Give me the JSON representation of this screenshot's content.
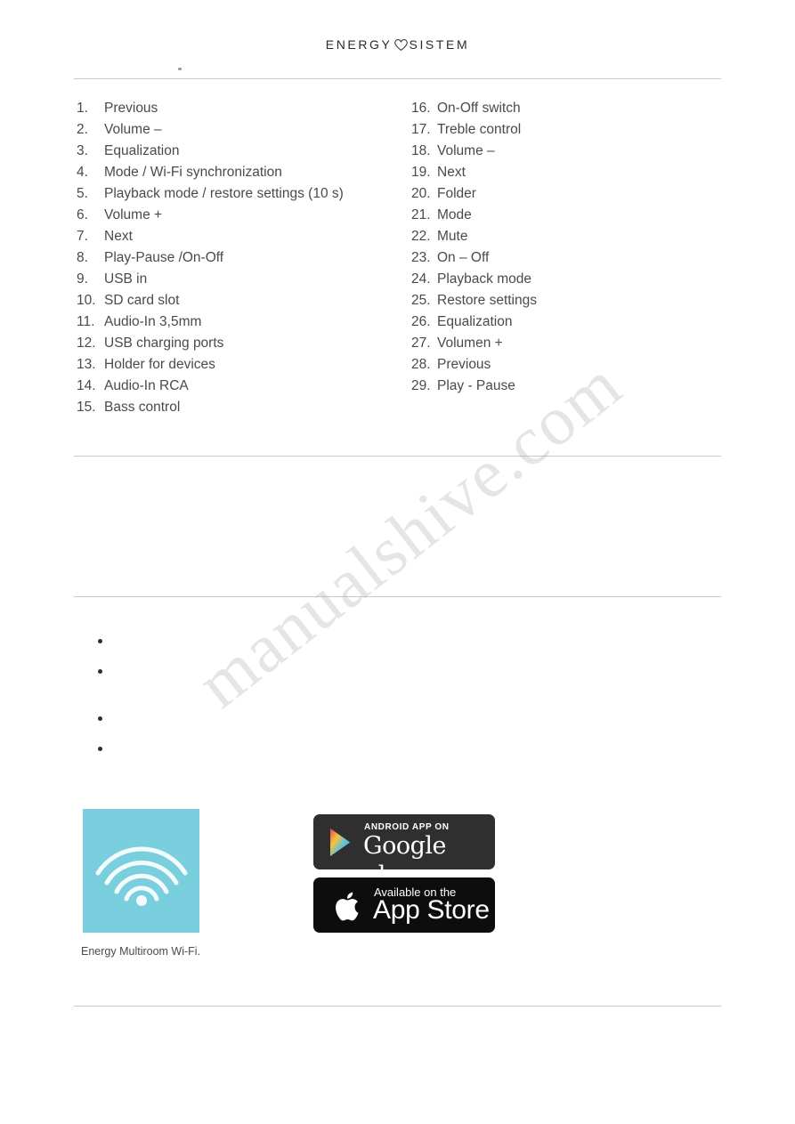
{
  "header": {
    "brand_left": "ENERGY",
    "brand_right": "SISTEM",
    "heart_icon": "heart-icon"
  },
  "parts_list": {
    "left_column": [
      {
        "num": "1.",
        "label": "Previous"
      },
      {
        "num": "2.",
        "label": "Volume –"
      },
      {
        "num": "3.",
        "label": "Equalization"
      },
      {
        "num": "4.",
        "label": "Mode / Wi-Fi synchronization"
      },
      {
        "num": "5.",
        "label": "Playback mode / restore settings (10 s)"
      },
      {
        "num": "6.",
        "label": "Volume +"
      },
      {
        "num": "7.",
        "label": "Next"
      },
      {
        "num": "8.",
        "label": "Play-Pause /On-Off"
      },
      {
        "num": "9.",
        "label": "USB in"
      },
      {
        "num": "10.",
        "label": "SD card slot"
      },
      {
        "num": "11.",
        "label": "Audio-In 3,5mm"
      },
      {
        "num": "12.",
        "label": "USB charging ports"
      },
      {
        "num": "13.",
        "label": "Holder for devices"
      },
      {
        "num": "14.",
        "label": "Audio-In RCA"
      },
      {
        "num": "15.",
        "label": "Bass control"
      }
    ],
    "right_column": [
      {
        "num": "16.",
        "label": "On-Off switch"
      },
      {
        "num": "17.",
        "label": "Treble control"
      },
      {
        "num": "18.",
        "label": "Volume –"
      },
      {
        "num": "19.",
        "label": "Next"
      },
      {
        "num": "20.",
        "label": "Folder"
      },
      {
        "num": "21.",
        "label": "Mode"
      },
      {
        "num": "22.",
        "label": "Mute"
      },
      {
        "num": "23.",
        "label": "On – Off"
      },
      {
        "num": "24.",
        "label": "Playback mode"
      },
      {
        "num": "25.",
        "label": "Restore settings"
      },
      {
        "num": "26.",
        "label": "Equalization"
      },
      {
        "num": "27.",
        "label": "Volumen +"
      },
      {
        "num": "28.",
        "label": "Previous"
      },
      {
        "num": "29.",
        "label": "Play - Pause"
      }
    ]
  },
  "app_section": {
    "icon_name": "wifi-multiroom-app-icon",
    "caption": "Energy Multiroom Wi-Fi.",
    "google_badge": {
      "top_line": "ANDROID APP ON",
      "main_line": "Google play",
      "icon_name": "google-play-triangle-icon"
    },
    "apple_badge": {
      "top_line": "Available on the",
      "main_line": "App Store",
      "icon_name": "apple-logo-icon"
    }
  },
  "watermark": {
    "text": "manualshive.com"
  },
  "colors": {
    "app_icon_bg": "#79cfde",
    "text": "#4a4a4a",
    "rule": "#c9c9c9"
  }
}
